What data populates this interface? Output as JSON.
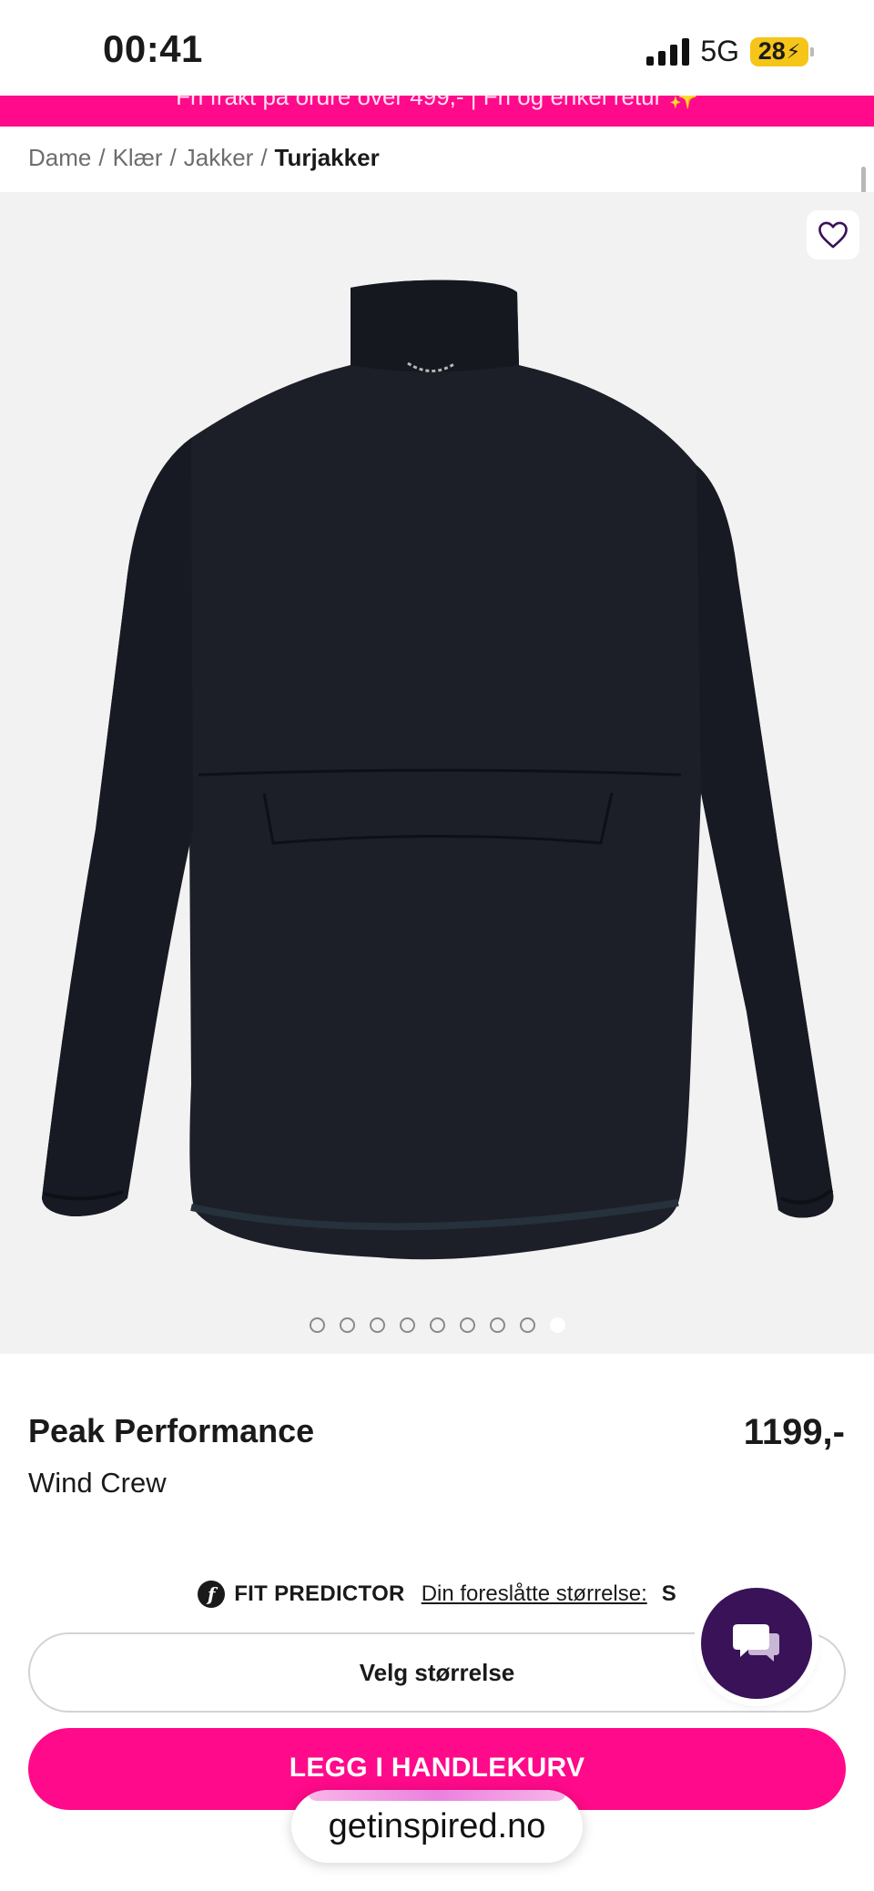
{
  "status_bar": {
    "time": "00:41",
    "network": "5G",
    "battery": "28"
  },
  "promo": {
    "text": "Fri frakt på ordre over 499,- | Fri og enkel retur ✨"
  },
  "breadcrumb": {
    "items": [
      "Dame",
      "Klær",
      "Jakker"
    ],
    "separator": "/",
    "current": "Turjakker"
  },
  "gallery": {
    "image_count": 9,
    "active_index": 8
  },
  "product": {
    "brand": "Peak Performance",
    "name": "Wind Crew",
    "price": "1199,-"
  },
  "fit_predictor": {
    "logo": "f",
    "title": "FIT PREDICTOR",
    "link_label": "Din foreslåtte størrelse:",
    "suggested_size": "S"
  },
  "size_select": {
    "label": "Velg størrelse"
  },
  "cart": {
    "button_label": "LEGG I HANDLEKURV"
  },
  "browser": {
    "url": "getinspired.no"
  },
  "colors": {
    "accent": "#ff0a8a",
    "chat": "#3a1258",
    "image_bg": "#f2f2f2"
  },
  "icons": [
    "heart-icon",
    "chat-icon",
    "fit-predictor-logo-icon"
  ]
}
